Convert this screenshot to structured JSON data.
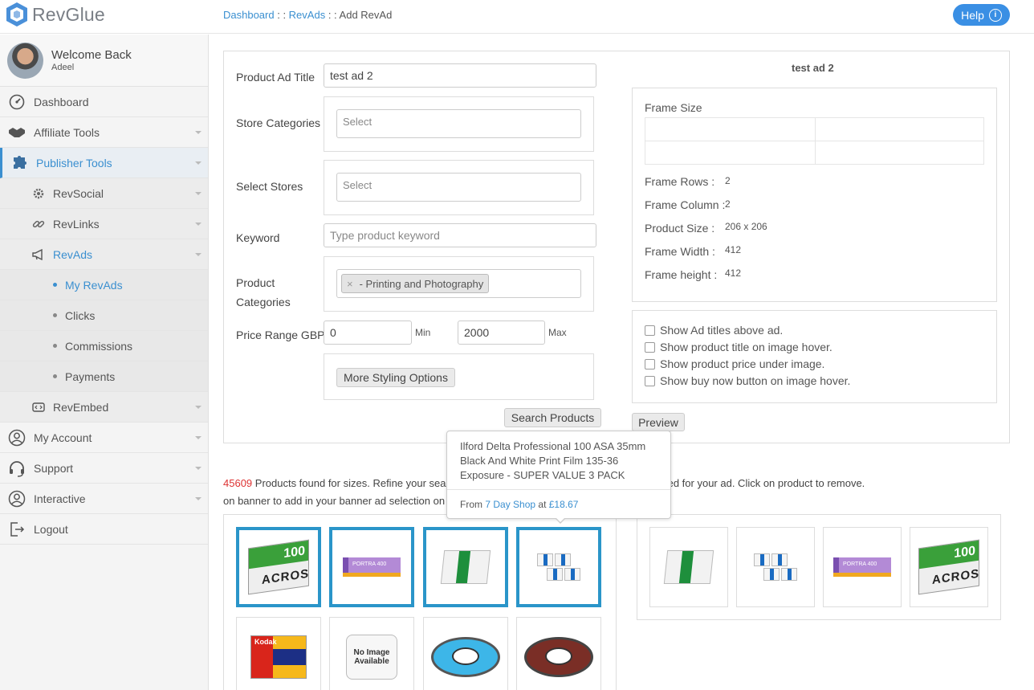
{
  "brand": {
    "name": "RevGlue"
  },
  "breadcrumb": {
    "dashboard": "Dashboard",
    "sep1": " : : ",
    "revads": "RevAds",
    "sep2": " : : Add RevAd"
  },
  "help": {
    "label": "Help",
    "icon": "info-icon"
  },
  "profile": {
    "welcome": "Welcome Back",
    "user": "Adeel"
  },
  "sidebar": {
    "dashboard": "Dashboard",
    "affiliate_tools": "Affiliate Tools",
    "publisher_tools": "Publisher Tools",
    "revsocial": "RevSocial",
    "revlinks": "RevLinks",
    "revads": "RevAds",
    "my_revads": "My RevAds",
    "clicks": "Clicks",
    "commissions": "Commissions",
    "payments": "Payments",
    "revembed": "RevEmbed",
    "my_account": "My Account",
    "support": "Support",
    "interactive": "Interactive",
    "logout": "Logout"
  },
  "form": {
    "title_label": "Product Ad Title",
    "title_value": "test ad 2",
    "store_categories_label": "Store Categories",
    "store_categories_placeholder": "Select",
    "select_stores_label": "Select Stores",
    "select_stores_placeholder": "Select",
    "keyword_label": "Keyword",
    "keyword_placeholder": "Type product keyword",
    "product_categories_label_1": "Product",
    "product_categories_label_2": "Categories",
    "product_category_tag": "- Printing and Photography",
    "price_range_label": "Price Range GBP",
    "price_min": "0",
    "min_label": "Min",
    "price_max": "2000",
    "max_label": "Max",
    "more_styling": "More Styling Options",
    "search_products": "Search Products"
  },
  "preview": {
    "title": "test ad 2",
    "frame_size_label": "Frame Size",
    "frame_rows_label": "Frame Rows :",
    "frame_rows": "2",
    "frame_column_label": "Frame Column :",
    "frame_column": "2",
    "product_size_label": "Product Size :",
    "product_size": "206 x 206",
    "frame_width_label": "Frame Width :",
    "frame_width": "412",
    "frame_height_label": "Frame height :",
    "frame_height": "412",
    "options": [
      "Show Ad titles above ad.",
      "Show product title on image hover.",
      "Show product price under image.",
      "Show buy now button on image hover."
    ],
    "preview_button": "Preview"
  },
  "results": {
    "count": "45609",
    "text_a": " Products found for sizes. Refine your searc",
    "text_b": "on banner to add in your banner ad selection on",
    "text_c": "ted for your ad. Click on product to remove."
  },
  "tooltip": {
    "title": "Ilford Delta Professional 100 ASA 35mm Black And White Print Film 135-36 Exposure - SUPER VALUE 3 PACK",
    "from": "From ",
    "store": "7 Day Shop",
    "at": " at ",
    "price": "£18.67"
  },
  "products": {
    "acros_brand": "ACROS",
    "acros_iso": "100",
    "portra": "PORTRA 400",
    "hp5": "HP5",
    "kodak": "Kodak",
    "no_image_1": "No Image",
    "no_image_2": "Available"
  },
  "colors": {
    "accent": "#3a8fd0",
    "selected_border": "#2a95c9",
    "count_red": "#dd3333"
  }
}
